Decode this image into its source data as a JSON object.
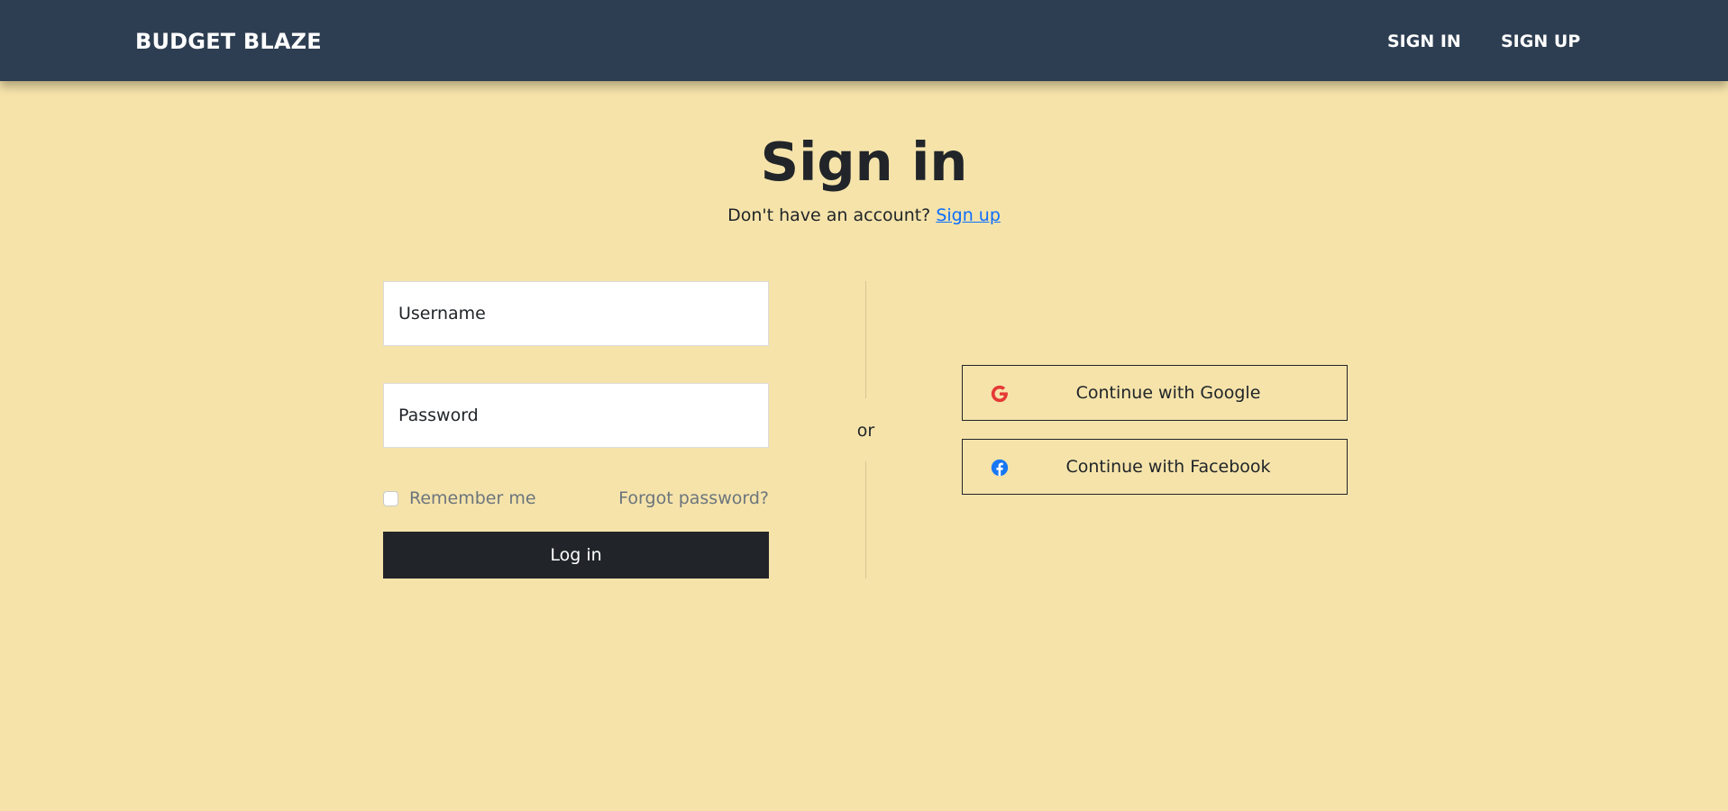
{
  "navbar": {
    "brand": "BUDGET BLAZE",
    "links": [
      {
        "label": "SIGN IN"
      },
      {
        "label": "SIGN UP"
      }
    ]
  },
  "header": {
    "title": "Sign in",
    "subtitle_text": "Don't have an account? ",
    "subtitle_link": "Sign up"
  },
  "form": {
    "username": {
      "placeholder": "Username",
      "value": ""
    },
    "password": {
      "placeholder": "Password",
      "value": ""
    },
    "remember_label": "Remember me",
    "remember_checked": false,
    "forgot_label": "Forgot password?",
    "login_label": "Log in"
  },
  "divider": {
    "label": "or"
  },
  "social": {
    "google": {
      "label": "Continue with Google",
      "icon": "google-icon",
      "color": "#e53935"
    },
    "facebook": {
      "label": "Continue with Facebook",
      "icon": "facebook-icon",
      "color": "#1877f2"
    }
  },
  "colors": {
    "background": "#f5e3aa",
    "navbar": "#2e3e52",
    "primary_button": "#212529",
    "link": "#0d6efd",
    "muted_text": "#6c757d"
  }
}
